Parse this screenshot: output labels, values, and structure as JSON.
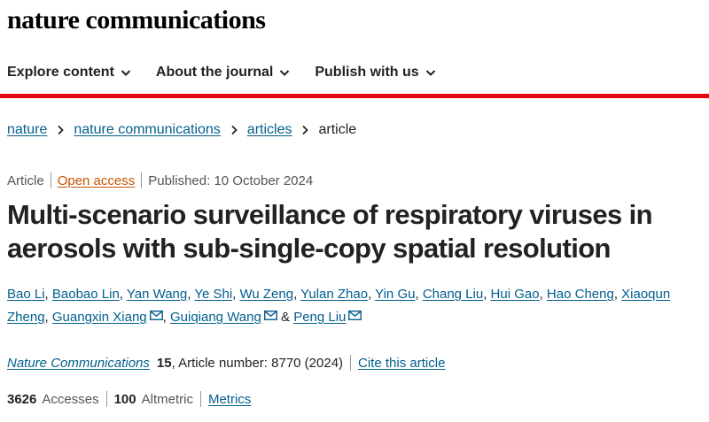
{
  "brand": "nature communications",
  "nav": [
    {
      "label": "Explore content"
    },
    {
      "label": "About the journal"
    },
    {
      "label": "Publish with us"
    }
  ],
  "breadcrumb": [
    "nature",
    "nature communications",
    "articles",
    "article"
  ],
  "meta": {
    "type": "Article",
    "access": "Open access",
    "published": "Published: 10 October 2024"
  },
  "title": "Multi-scenario surveillance of respiratory viruses in aerosols with sub-single-copy spatial resolution",
  "authors": [
    "Bao Li",
    "Baobao Lin",
    "Yan Wang",
    "Ye Shi",
    "Wu Zeng",
    "Yulan Zhao",
    "Yin Gu",
    "Chang Liu",
    "Hui Gao",
    "Hao Cheng",
    "Xiaoqun Zheng",
    "Guangxin Xiang",
    "Guiqiang Wang",
    "Peng Liu"
  ],
  "author_separators": {
    "comma": ",",
    "and": "&"
  },
  "citation": {
    "journal": "Nature Communications",
    "volume": "15",
    "article": ", Article number: 8770 (2024)",
    "cite_link": "Cite this article"
  },
  "metrics": {
    "accesses_value": "3626",
    "accesses_label": "Accesses",
    "altmetric_value": "100",
    "altmetric_label": "Altmetric",
    "metrics_link": "Metrics"
  },
  "colors": {
    "accent_red": "#e30613",
    "link_blue": "#025e8d",
    "open_access_orange": "#c65301"
  }
}
